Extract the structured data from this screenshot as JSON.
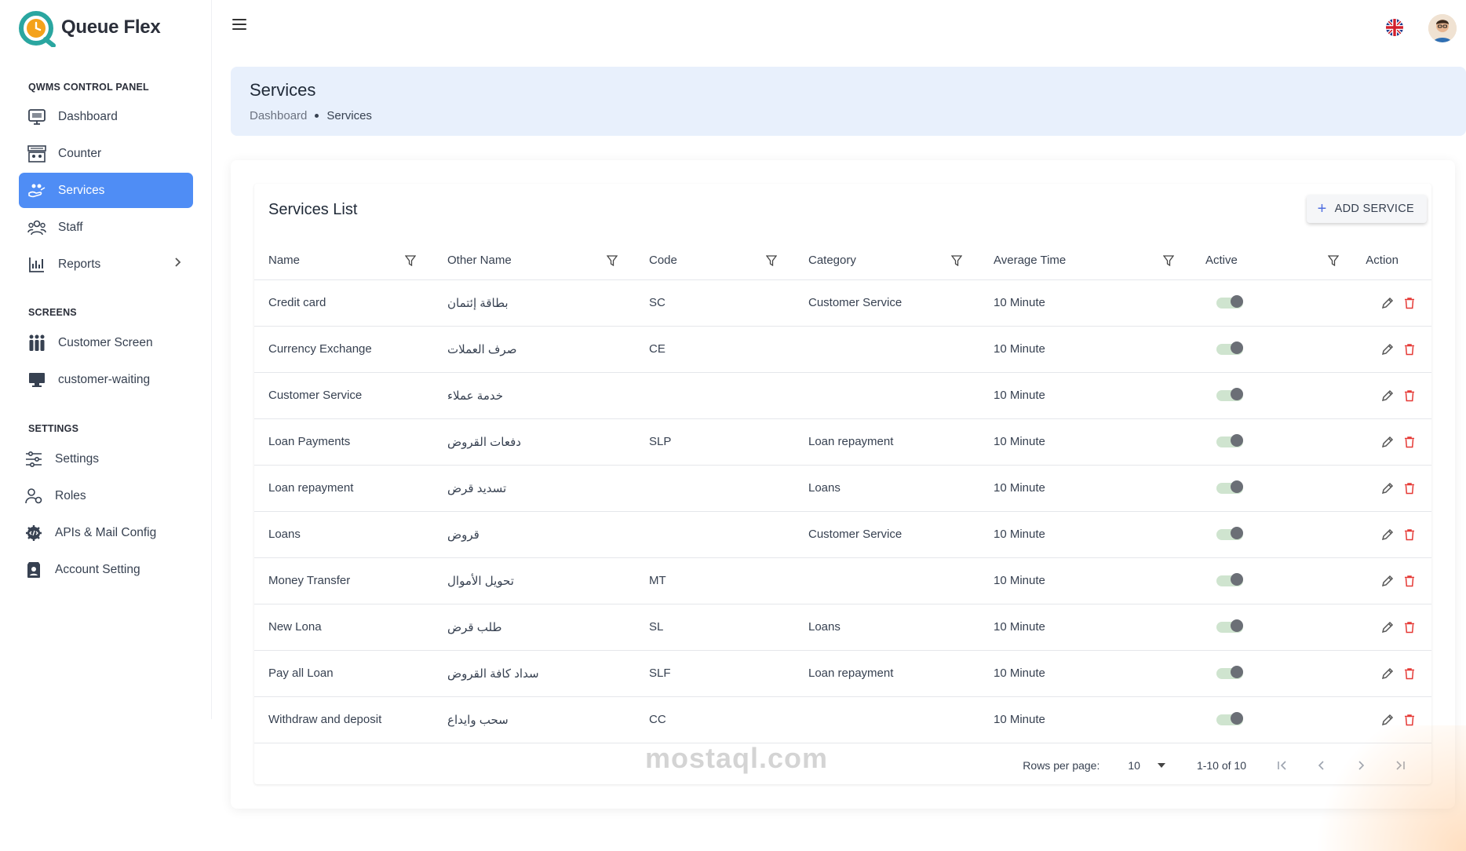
{
  "app": {
    "logo_text": "Queue Flex"
  },
  "sidebar": {
    "sections": [
      {
        "title": "QWMS CONTROL PANEL"
      },
      {
        "title": "SCREENS"
      },
      {
        "title": "SETTINGS"
      }
    ],
    "items": [
      {
        "label": "Dashboard",
        "icon": "monitor-icon"
      },
      {
        "label": "Counter",
        "icon": "counter-icon"
      },
      {
        "label": "Services",
        "icon": "services-icon",
        "active": true
      },
      {
        "label": "Staff",
        "icon": "staff-icon"
      },
      {
        "label": "Reports",
        "icon": "chart-icon"
      },
      {
        "label": "Customer Screen",
        "icon": "people-icon"
      },
      {
        "label": "customer-waiting",
        "icon": "desktop-icon"
      },
      {
        "label": "Settings",
        "icon": "sliders-icon"
      },
      {
        "label": "Roles",
        "icon": "roles-icon"
      },
      {
        "label": "APIs & Mail Config",
        "icon": "code-gear-icon"
      },
      {
        "label": "Account Setting",
        "icon": "account-icon"
      }
    ]
  },
  "header": {
    "title": "Services",
    "breadcrumb": [
      "Dashboard",
      "Services"
    ]
  },
  "list": {
    "title": "Services List",
    "add_button": "ADD SERVICE",
    "columns": [
      "Name",
      "Other Name",
      "Code",
      "Category",
      "Average Time",
      "Active",
      "Action"
    ],
    "rows": [
      {
        "name": "Credit card",
        "other": "بطاقة إئتمان",
        "code": "SC",
        "category": "Customer Service",
        "avg": "10 Minute",
        "active": true
      },
      {
        "name": "Currency Exchange",
        "other": "صرف العملات",
        "code": "CE",
        "category": "",
        "avg": "10 Minute",
        "active": true
      },
      {
        "name": "Customer Service",
        "other": "خدمة عملاء",
        "code": "",
        "category": "",
        "avg": "10 Minute",
        "active": true
      },
      {
        "name": "Loan Payments",
        "other": "دفعات القروض",
        "code": "SLP",
        "category": "Loan repayment",
        "avg": "10 Minute",
        "active": true
      },
      {
        "name": "Loan repayment",
        "other": "تسديد قرض",
        "code": "",
        "category": "Loans",
        "avg": "10 Minute",
        "active": true
      },
      {
        "name": "Loans",
        "other": "قروض",
        "code": "",
        "category": "Customer Service",
        "avg": "10 Minute",
        "active": true
      },
      {
        "name": "Money Transfer",
        "other": "تحويل الأموال",
        "code": "MT",
        "category": "",
        "avg": "10 Minute",
        "active": true
      },
      {
        "name": "New Lona",
        "other": "طلب قرض",
        "code": "SL",
        "category": "Loans",
        "avg": "10 Minute",
        "active": true
      },
      {
        "name": "Pay all Loan",
        "other": "سداد كافة القروض",
        "code": "SLF",
        "category": "Loan repayment",
        "avg": "10 Minute",
        "active": true
      },
      {
        "name": "Withdraw and deposit",
        "other": "سحب وايداع",
        "code": "CC",
        "category": "",
        "avg": "10 Minute",
        "active": true
      }
    ],
    "footer": {
      "rows_per_page_label": "Rows per page:",
      "rows_per_page": "10",
      "range": "1-10 of 10"
    }
  },
  "watermark": "mostaql.com",
  "colors": {
    "accent": "#4f8df5",
    "banner": "#e8f0fc",
    "delete": "#e53935"
  }
}
